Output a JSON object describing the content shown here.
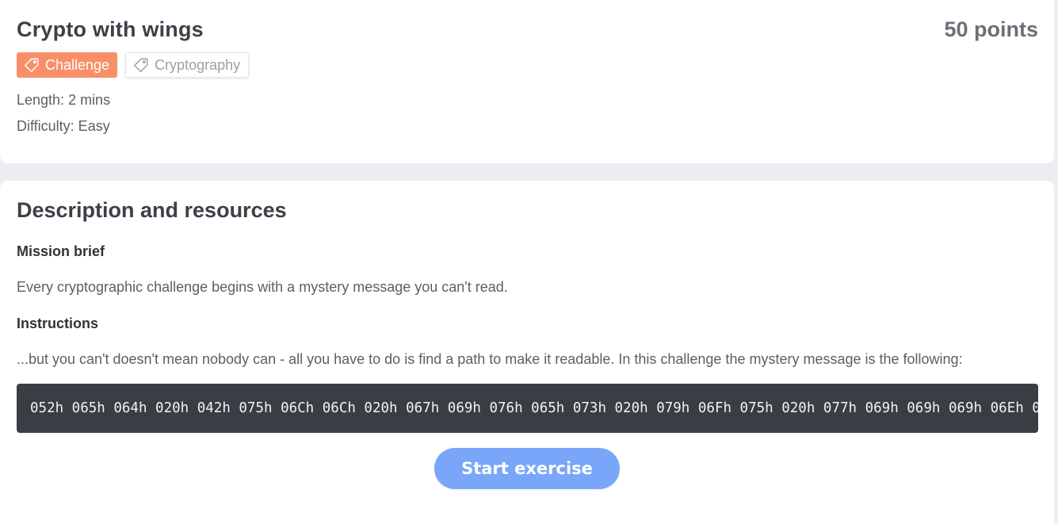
{
  "challenge": {
    "title": "Crypto with wings",
    "points": "50 points",
    "tags": [
      {
        "label": "Challenge",
        "icon": "tag-icon",
        "color": "#f88f68"
      },
      {
        "label": "Cryptography",
        "icon": "tag-icon"
      }
    ],
    "length": "Length: 2 mins",
    "difficulty": "Difficulty: Easy"
  },
  "description": {
    "section_title": "Description and resources",
    "mission_heading": "Mission brief",
    "mission_text": "Every cryptographic challenge begins with a mystery message you can't read.",
    "instructions_heading": "Instructions",
    "instructions_text": "...but you can't doesn't mean nobody can - all you have to do is find a path to make it readable. In this challenge the mystery message is the following:",
    "mystery_message": "052h 065h 064h 020h 042h 075h 06Ch 06Ch 020h 067h 069h 076h 065h 073h 020h 079h 06Fh 075h 020h 077h 069h 069h 069h 06Eh 0"
  },
  "actions": {
    "start_label": "Start exercise",
    "accent_color": "#7aa6f9"
  }
}
